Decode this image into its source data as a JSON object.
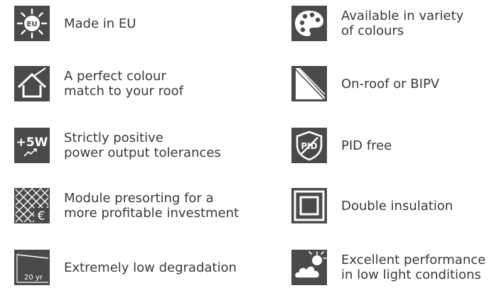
{
  "features": [
    {
      "icon": "eu-sun-icon",
      "lines": [
        "Made in EU"
      ]
    },
    {
      "icon": "palette-icon",
      "lines": [
        "Available in variety",
        "of colours"
      ]
    },
    {
      "icon": "house-roof-icon",
      "lines": [
        "A perfect colour",
        "match to your roof"
      ]
    },
    {
      "icon": "roof-mount-icon",
      "lines": [
        "On-roof or BIPV"
      ]
    },
    {
      "icon": "plus-5w-icon",
      "badge_text": "+5W",
      "lines": [
        "Strictly positive",
        "power output tolerances"
      ]
    },
    {
      "icon": "pid-shield-icon",
      "badge_text": "PID",
      "lines": [
        "PID free"
      ]
    },
    {
      "icon": "module-euro-icon",
      "badge_text": "€",
      "lines": [
        "Module presorting for a",
        "more profitable investment"
      ]
    },
    {
      "icon": "double-square-icon",
      "lines": [
        "Double insulation"
      ]
    },
    {
      "icon": "degradation-graph-icon",
      "badge_text": "20 yr",
      "lines": [
        "Extremely low degradation"
      ]
    },
    {
      "icon": "cloud-sun-icon",
      "lines": [
        "Excellent performance",
        "in low light conditions"
      ]
    }
  ]
}
